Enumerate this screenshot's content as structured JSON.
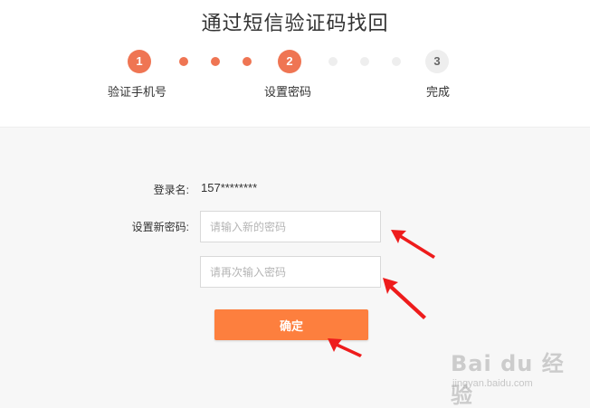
{
  "page": {
    "title": "通过短信验证码找回"
  },
  "stepper": {
    "steps": [
      {
        "number": "1",
        "label": "验证手机号",
        "state": "done"
      },
      {
        "number": "2",
        "label": "设置密码",
        "state": "current"
      },
      {
        "number": "3",
        "label": "完成",
        "state": "pending"
      }
    ],
    "accent_color": "#ef7553",
    "inactive_color": "#eeeeee"
  },
  "form": {
    "login_label": "登录名:",
    "login_value": "157********",
    "new_password_label": "设置新密码:",
    "new_password_placeholder": "请输入新的密码",
    "confirm_password_placeholder": "请再次输入密码",
    "submit_label": "确定",
    "button_color": "#fd7f3e"
  },
  "annotations": {
    "arrow_color": "#ee1c1c"
  },
  "watermark": {
    "logo_text": "Bai du 经验",
    "url": "jingyan.baidu.com"
  }
}
